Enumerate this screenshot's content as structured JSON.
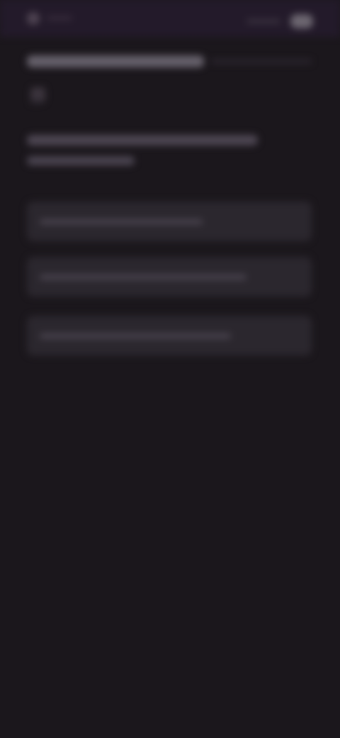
{
  "screen": {
    "state": "blurred",
    "text_legible": false
  },
  "status_bar": {
    "left_icon": "status-indicator-icon",
    "right_icon": "toggle-or-badge-icon"
  },
  "content": {
    "title": "",
    "subtitle": "",
    "heading": "",
    "heading_continuation": "",
    "options": [
      "",
      "",
      ""
    ]
  },
  "colors": {
    "background": "#1b171c",
    "status_bar": "#231a2a",
    "option_background": "#2b272e"
  }
}
